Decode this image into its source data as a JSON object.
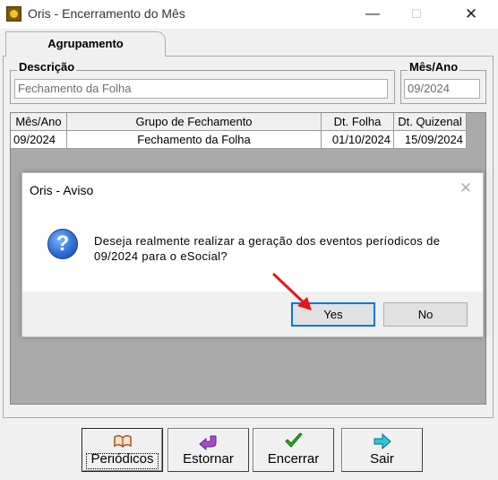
{
  "window": {
    "title": "Oris - Encerramento do Mês",
    "minimize_glyph": "—",
    "maximize_glyph": "☐",
    "close_glyph": "✕"
  },
  "tabs": [
    {
      "label": "Agrupamento"
    }
  ],
  "form": {
    "descricao_label": "Descrição",
    "descricao_value": "Fechamento da Folha",
    "mes_ano_label": "Mês/Ano",
    "mes_ano_value": "09/2024"
  },
  "grid": {
    "columns": [
      "Mês/Ano",
      "Grupo de Fechamento",
      "Dt. Folha",
      "Dt. Quizenal"
    ],
    "rows": [
      [
        "09/2024",
        "Fechamento da Folha",
        "01/10/2024",
        "15/09/2024"
      ]
    ]
  },
  "dialog": {
    "title": "Oris - Aviso",
    "icon": "question-icon",
    "message": "Deseja realmente realizar a geração dos eventos períodicos de 09/2024 para o eSocial?",
    "yes_label": "Yes",
    "no_label": "No",
    "close_glyph": "✕"
  },
  "toolbar": {
    "periodicos_label": "Periódicos",
    "estornar_label": "Estornar",
    "encerrar_label": "Encerrar",
    "sair_label": "Sair"
  },
  "colors": {
    "accent_arrow": "#e8141b",
    "focus_border": "#0078d7",
    "grid_background": "#aaaaaa"
  }
}
